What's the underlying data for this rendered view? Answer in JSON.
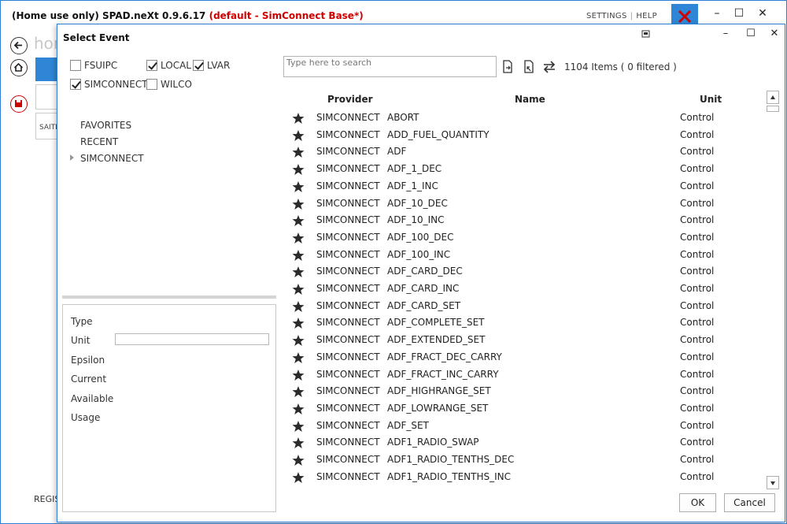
{
  "main": {
    "title_prefix": "(Home use only) SPAD.neXt 0.9.6.17",
    "title_profile": "(default - SimConnect Base*)",
    "link_settings": "SETTINGS",
    "link_sep": "|",
    "link_help": "HELP",
    "home_text": "hor",
    "saitek_text": "SAITE",
    "regis_text": "REGIS"
  },
  "dialog": {
    "title": "Select Event",
    "filters": [
      {
        "label": "FSUIPC",
        "checked": false
      },
      {
        "label": "LOCAL",
        "checked": true
      },
      {
        "label": "LVAR",
        "checked": true
      },
      {
        "label": "SIMCONNECT",
        "checked": true
      },
      {
        "label": "WILCO",
        "checked": false
      }
    ],
    "tree": {
      "favorites": "FAVORITES",
      "recent": "RECENT",
      "simconnect": "SIMCONNECT"
    },
    "properties": {
      "type": "Type",
      "unit": "Unit",
      "epsilon": "Epsilon",
      "current": "Current",
      "available": "Available",
      "usage": "Usage"
    },
    "search": {
      "placeholder": "Type here to search",
      "value": ""
    },
    "items_count": "1104 Items ( 0 filtered )",
    "columns": {
      "provider": "Provider",
      "name": "Name",
      "unit": "Unit"
    },
    "rows": [
      {
        "provider": "SIMCONNECT",
        "name": "ABORT",
        "unit": "Control"
      },
      {
        "provider": "SIMCONNECT",
        "name": "ADD_FUEL_QUANTITY",
        "unit": "Control"
      },
      {
        "provider": "SIMCONNECT",
        "name": "ADF",
        "unit": "Control"
      },
      {
        "provider": "SIMCONNECT",
        "name": "ADF_1_DEC",
        "unit": "Control"
      },
      {
        "provider": "SIMCONNECT",
        "name": "ADF_1_INC",
        "unit": "Control"
      },
      {
        "provider": "SIMCONNECT",
        "name": "ADF_10_DEC",
        "unit": "Control"
      },
      {
        "provider": "SIMCONNECT",
        "name": "ADF_10_INC",
        "unit": "Control"
      },
      {
        "provider": "SIMCONNECT",
        "name": "ADF_100_DEC",
        "unit": "Control"
      },
      {
        "provider": "SIMCONNECT",
        "name": "ADF_100_INC",
        "unit": "Control"
      },
      {
        "provider": "SIMCONNECT",
        "name": "ADF_CARD_DEC",
        "unit": "Control"
      },
      {
        "provider": "SIMCONNECT",
        "name": "ADF_CARD_INC",
        "unit": "Control"
      },
      {
        "provider": "SIMCONNECT",
        "name": "ADF_CARD_SET",
        "unit": "Control"
      },
      {
        "provider": "SIMCONNECT",
        "name": "ADF_COMPLETE_SET",
        "unit": "Control"
      },
      {
        "provider": "SIMCONNECT",
        "name": "ADF_EXTENDED_SET",
        "unit": "Control"
      },
      {
        "provider": "SIMCONNECT",
        "name": "ADF_FRACT_DEC_CARRY",
        "unit": "Control"
      },
      {
        "provider": "SIMCONNECT",
        "name": "ADF_FRACT_INC_CARRY",
        "unit": "Control"
      },
      {
        "provider": "SIMCONNECT",
        "name": "ADF_HIGHRANGE_SET",
        "unit": "Control"
      },
      {
        "provider": "SIMCONNECT",
        "name": "ADF_LOWRANGE_SET",
        "unit": "Control"
      },
      {
        "provider": "SIMCONNECT",
        "name": "ADF_SET",
        "unit": "Control"
      },
      {
        "provider": "SIMCONNECT",
        "name": "ADF1_RADIO_SWAP",
        "unit": "Control"
      },
      {
        "provider": "SIMCONNECT",
        "name": "ADF1_RADIO_TENTHS_DEC",
        "unit": "Control"
      },
      {
        "provider": "SIMCONNECT",
        "name": "ADF1_RADIO_TENTHS_INC",
        "unit": "Control"
      }
    ],
    "ok_label": "OK",
    "cancel_label": "Cancel"
  },
  "colors": {
    "accent": "#2f86d6",
    "profile_red": "#d00000"
  }
}
